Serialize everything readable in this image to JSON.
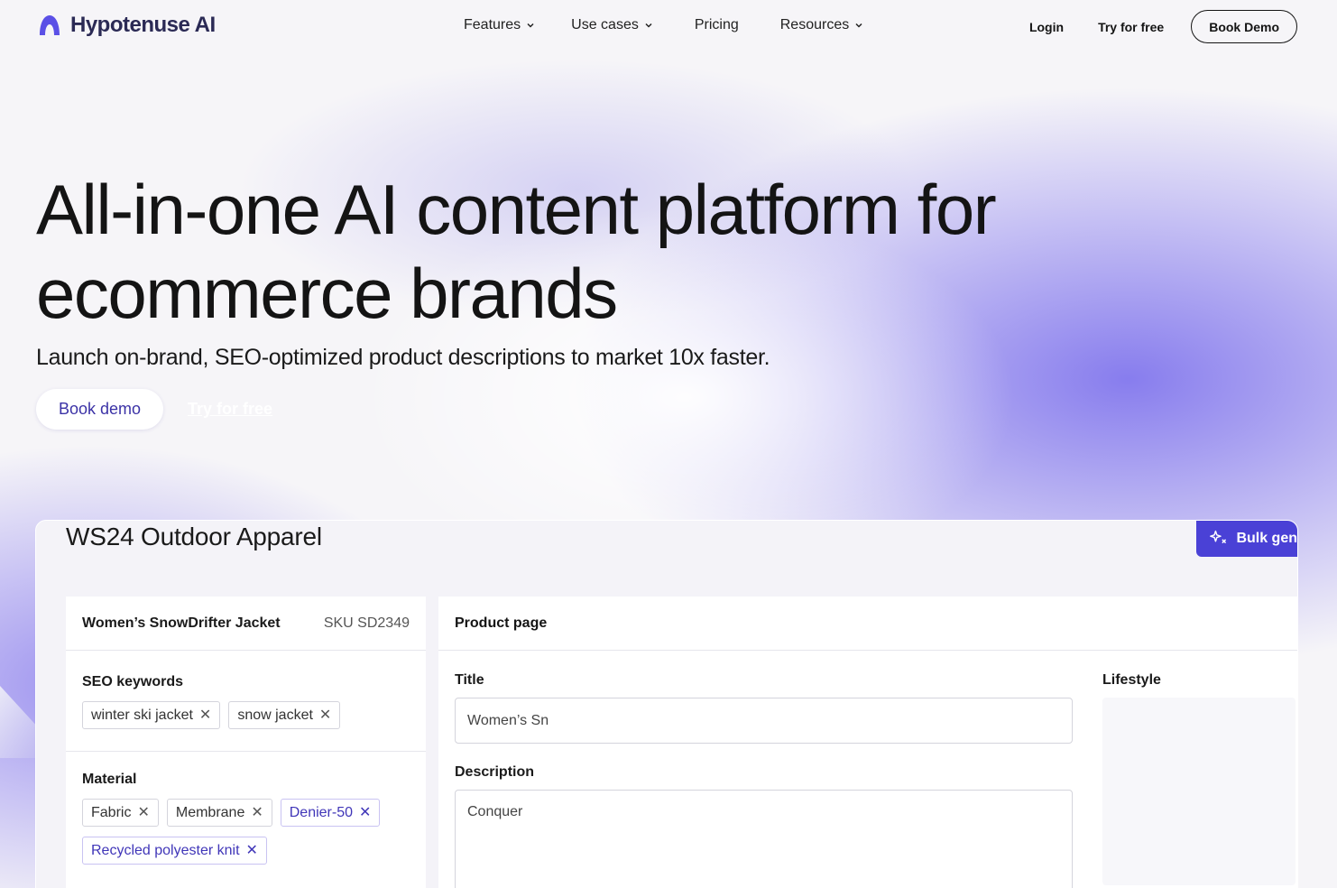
{
  "nav": {
    "logo_text": "Hypotenuse AI",
    "links": [
      {
        "label": "Features",
        "has_dropdown": true
      },
      {
        "label": "Use cases",
        "has_dropdown": true
      },
      {
        "label": "Pricing",
        "has_dropdown": false
      },
      {
        "label": "Resources",
        "has_dropdown": true
      }
    ],
    "login": "Login",
    "try_free": "Try for free",
    "book_demo": "Book Demo"
  },
  "hero": {
    "title": "All-in-one AI content platform for ecommerce brands",
    "subtitle": "Launch on-brand, SEO-optimized product descriptions to market 10x faster.",
    "cta_demo": "Book demo",
    "cta_try": "Try for free"
  },
  "app": {
    "title": "WS24 Outdoor Apparel",
    "bulk_button": "Bulk gen",
    "product": {
      "name": "Women’s SnowDrifter Jacket",
      "sku": "SKU SD2349"
    },
    "seo": {
      "label": "SEO keywords",
      "keywords": [
        "winter ski jacket",
        "snow jacket"
      ]
    },
    "material": {
      "label": "Material",
      "chips": [
        "Fabric",
        "Membrane",
        "Denier-50",
        "Recycled polyester knit"
      ]
    },
    "product_page": {
      "header": "Product page",
      "title_label": "Title",
      "title_value": "Women’s Sn",
      "description_label": "Description",
      "description_value": "Conquer",
      "lifestyle_label": "Lifestyle"
    }
  },
  "colors": {
    "accent": "#4a41d6",
    "logo": "#5b50e6",
    "chip_purple": "#4036b8"
  }
}
